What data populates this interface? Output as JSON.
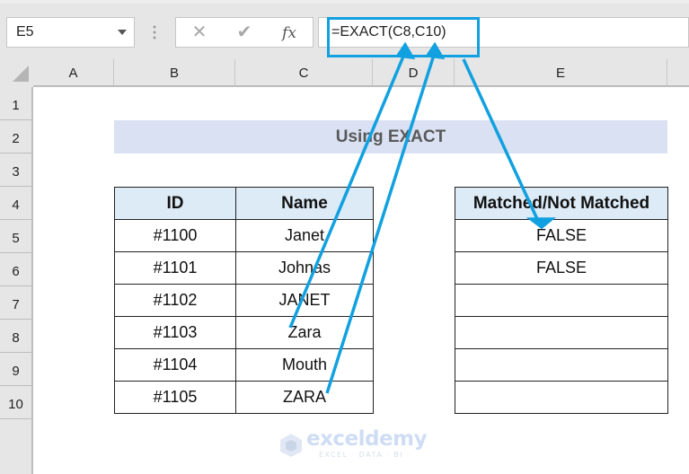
{
  "toolbar": {
    "name_box": "E5",
    "cancel_icon": "x-icon",
    "enter_icon": "check-icon",
    "function_icon": "fx",
    "formula": "=EXACT(C8,C10)"
  },
  "grid": {
    "columns": [
      "A",
      "B",
      "C",
      "D",
      "E"
    ],
    "rows": [
      "1",
      "2",
      "3",
      "4",
      "5",
      "6",
      "7",
      "8",
      "9",
      "10"
    ]
  },
  "sheet": {
    "title": "Using EXACT",
    "main_table": {
      "headers": [
        "ID",
        "Name"
      ],
      "rows": [
        [
          "#1100",
          "Janet"
        ],
        [
          "#1101",
          "Johnas"
        ],
        [
          "#1102",
          "JANET"
        ],
        [
          "#1103",
          "Zara"
        ],
        [
          "#1104",
          "Mouth"
        ],
        [
          "#1105",
          "ZARA"
        ]
      ]
    },
    "result_table": {
      "header": "Matched/Not Matched",
      "rows": [
        "FALSE",
        "FALSE",
        "",
        "",
        "",
        ""
      ]
    }
  },
  "annotation": {
    "color": "#11a0e0",
    "arrows": [
      "C8 to formula argument",
      "C10 to formula argument",
      "formula to E5"
    ]
  },
  "watermark": {
    "brand": "exceldemy",
    "tagline": "EXCEL · DATA · BI"
  }
}
